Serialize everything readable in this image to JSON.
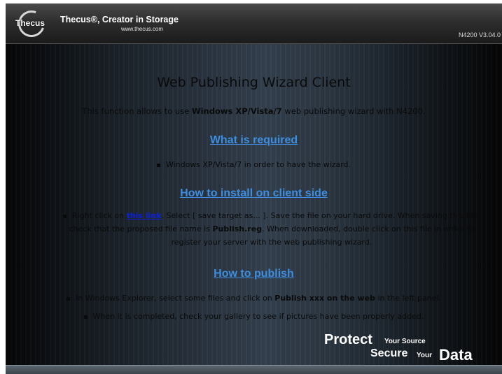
{
  "header": {
    "logo_text": "Thecus",
    "tagline": "Thecus®, Creator in Storage",
    "url": "www.thecus.com",
    "version": "N4200 V3.04.0"
  },
  "main": {
    "title": "Web Publishing Wizard Client",
    "intro": {
      "before": "This function allows to use ",
      "bold": "Windows XP/Vista/7",
      "after": " web publishing wizard with N4200."
    },
    "sections": {
      "required": {
        "heading": "What is required",
        "item": "Windows XP/Vista/7 in order to have the wizard."
      },
      "install": {
        "heading": "How to install on client side",
        "text_1": "Right click on ",
        "link": "this link",
        "text_2": ". Select [ save target as... ]. Save the file on your hard drive. When saving this file, check that the proposed file name is ",
        "file_name": "Publish.reg",
        "text_3": ". When downloaded, double click on this file in order to register your server with the web publishing wizard."
      },
      "publish": {
        "heading": "How to publish",
        "item1_before": "In Windows Explorer, select some files and click on ",
        "item1_bold": "Publish xxx on the web",
        "item1_after": " in the left panel.",
        "item2": "When it is completed, check your gallery to see if pictures have been properly added."
      }
    }
  },
  "slogan": {
    "protect": "Protect",
    "your_source": "Your Source",
    "secure": "Secure",
    "your": "Your",
    "data": "Data"
  }
}
